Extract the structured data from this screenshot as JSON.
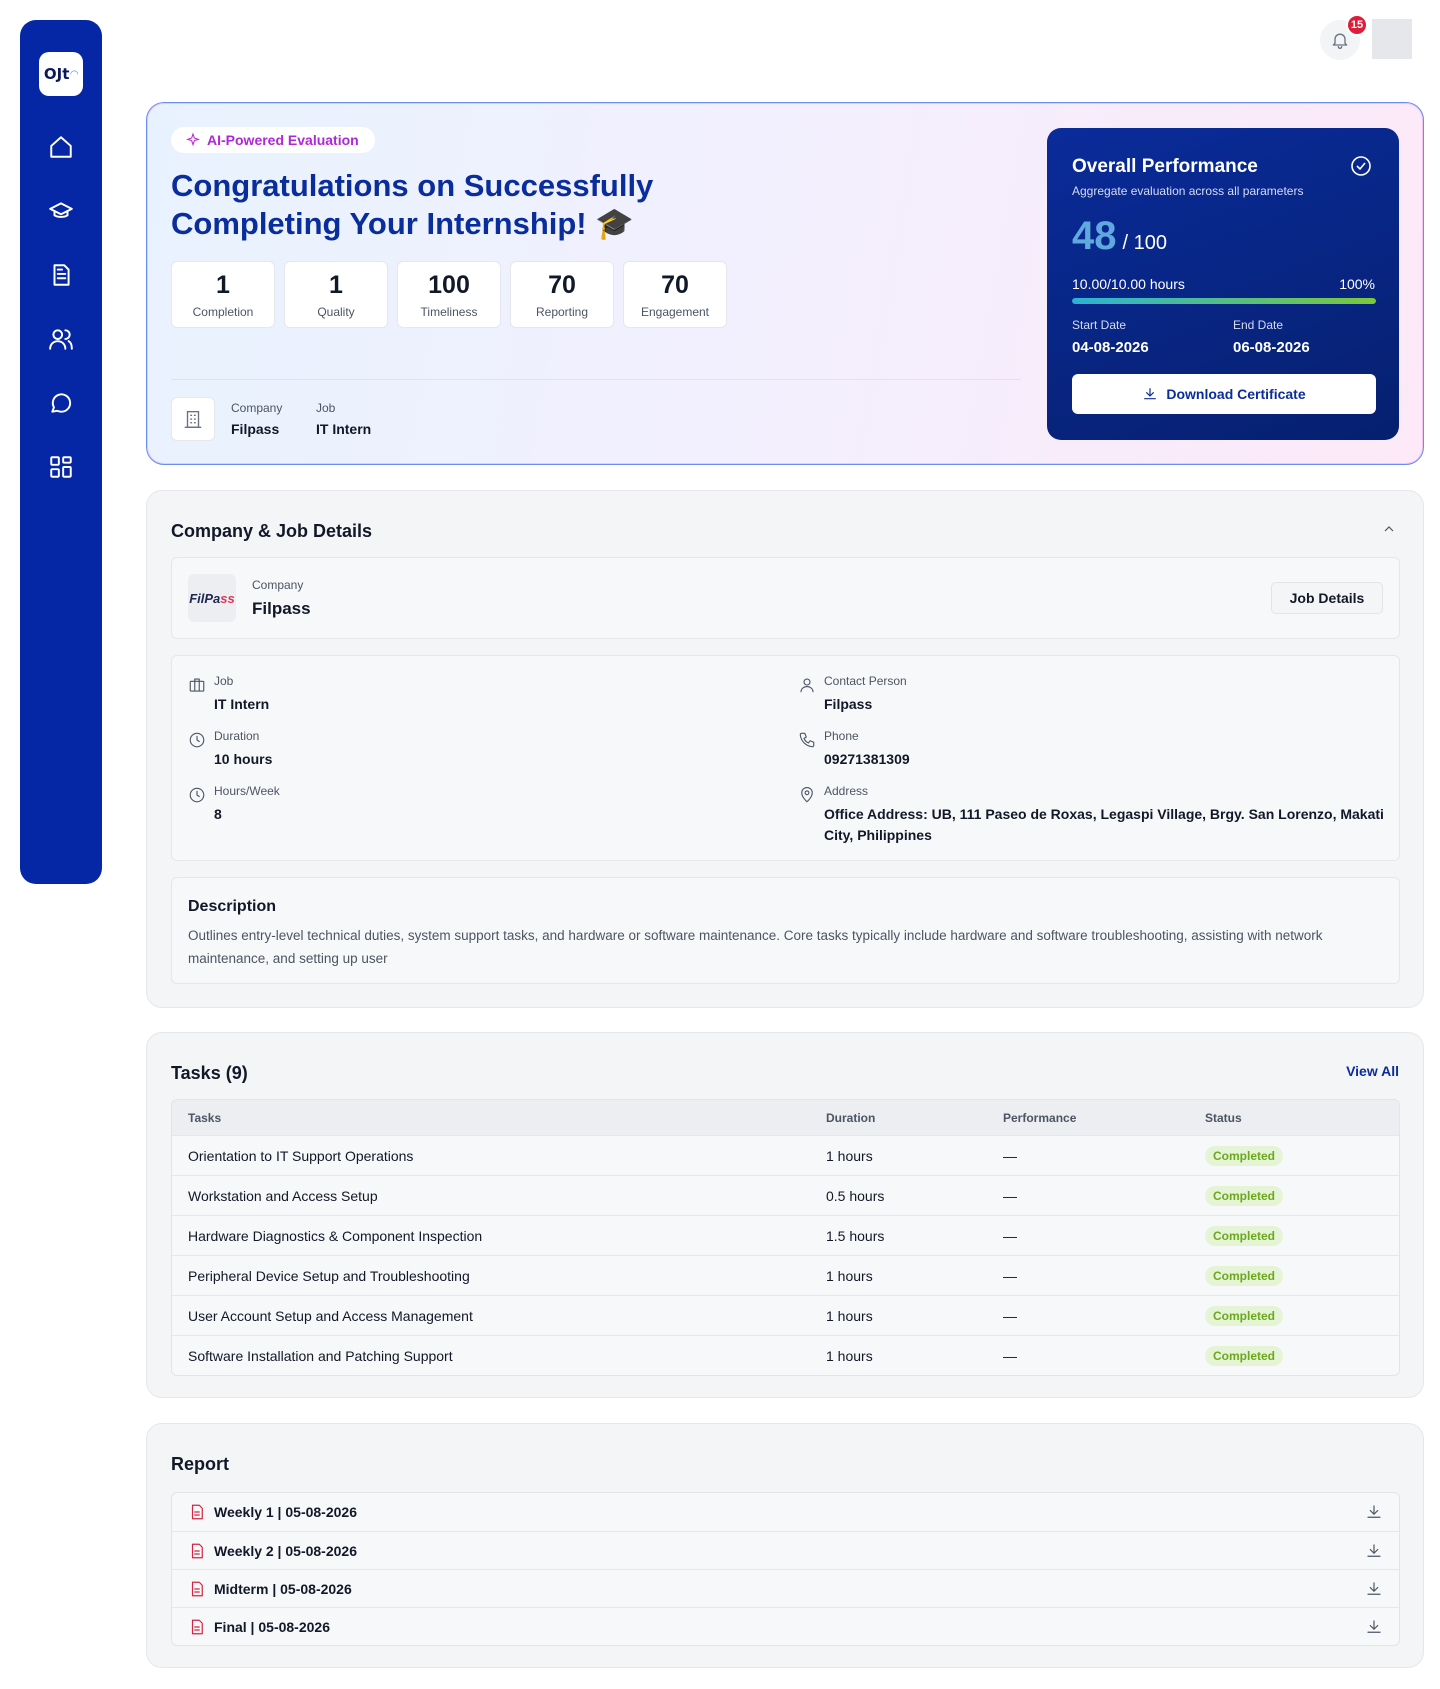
{
  "app": {
    "logo_text": "OJt"
  },
  "notifications": {
    "count": "15"
  },
  "hero": {
    "ai_label": "AI-Powered Evaluation",
    "title": "Congratulations on Successfully Completing Your Internship! 🎓",
    "stats": [
      {
        "value": "1",
        "label": "Completion"
      },
      {
        "value": "1",
        "label": "Quality"
      },
      {
        "value": "100",
        "label": "Timeliness"
      },
      {
        "value": "70",
        "label": "Reporting"
      },
      {
        "value": "70",
        "label": "Engagement"
      }
    ],
    "company_label": "Company",
    "company_value": "Filpass",
    "job_label": "Job",
    "job_value": "IT Intern"
  },
  "performance": {
    "title": "Overall Performance",
    "subtitle": "Aggregate evaluation across all parameters",
    "score": "48",
    "score_max": "/ 100",
    "hours": "10.00/10.00 hours",
    "percent_text": "100%",
    "progress": 1.0,
    "start_label": "Start Date",
    "start_value": "04-08-2026",
    "end_label": "End Date",
    "end_value": "06-08-2026",
    "download_label": "Download Certificate"
  },
  "company_job": {
    "title": "Company & Job Details",
    "logo_text_a": "FilPa",
    "logo_text_b": "ss",
    "company_label": "Company",
    "company_value": "Filpass",
    "job_details_button": "Job Details",
    "details": {
      "job_label": "Job",
      "job_value": "IT Intern",
      "duration_label": "Duration",
      "duration_value": "10 hours",
      "hours_week_label": "Hours/Week",
      "hours_week_value": "8",
      "contact_label": "Contact Person",
      "contact_value": "Filpass",
      "phone_label": "Phone",
      "phone_value": "09271381309",
      "address_label": "Address",
      "address_value": "Office Address: UB, 111 Paseo de Roxas, Legaspi Village, Brgy. San Lorenzo, Makati City, Philippines"
    },
    "description_title": "Description",
    "description_text": "Outlines entry-level technical duties, system support tasks, and hardware or software maintenance. Core tasks typically include hardware and software troubleshooting, assisting with network maintenance, and setting up user"
  },
  "tasks": {
    "title": "Tasks (9)",
    "view_all": "View All",
    "columns": [
      "Tasks",
      "Duration",
      "Performance",
      "Status"
    ],
    "rows": [
      {
        "task": "Orientation to IT Support Operations",
        "duration": "1 hours",
        "performance": "—",
        "status": "Completed"
      },
      {
        "task": "Workstation and Access Setup",
        "duration": "0.5 hours",
        "performance": "—",
        "status": "Completed"
      },
      {
        "task": "Hardware Diagnostics & Component Inspection",
        "duration": "1.5 hours",
        "performance": "—",
        "status": "Completed"
      },
      {
        "task": "Peripheral Device Setup and Troubleshooting",
        "duration": "1 hours",
        "performance": "—",
        "status": "Completed"
      },
      {
        "task": "User Account Setup and Access Management",
        "duration": "1 hours",
        "performance": "—",
        "status": "Completed"
      },
      {
        "task": "Software Installation and Patching Support",
        "duration": "1 hours",
        "performance": "—",
        "status": "Completed"
      }
    ]
  },
  "report": {
    "title": "Report",
    "items": [
      {
        "label": "Weekly 1 | 05-08-2026"
      },
      {
        "label": "Weekly 2 | 05-08-2026"
      },
      {
        "label": "Midterm | 05-08-2026"
      },
      {
        "label": "Final | 05-08-2026"
      }
    ]
  }
}
